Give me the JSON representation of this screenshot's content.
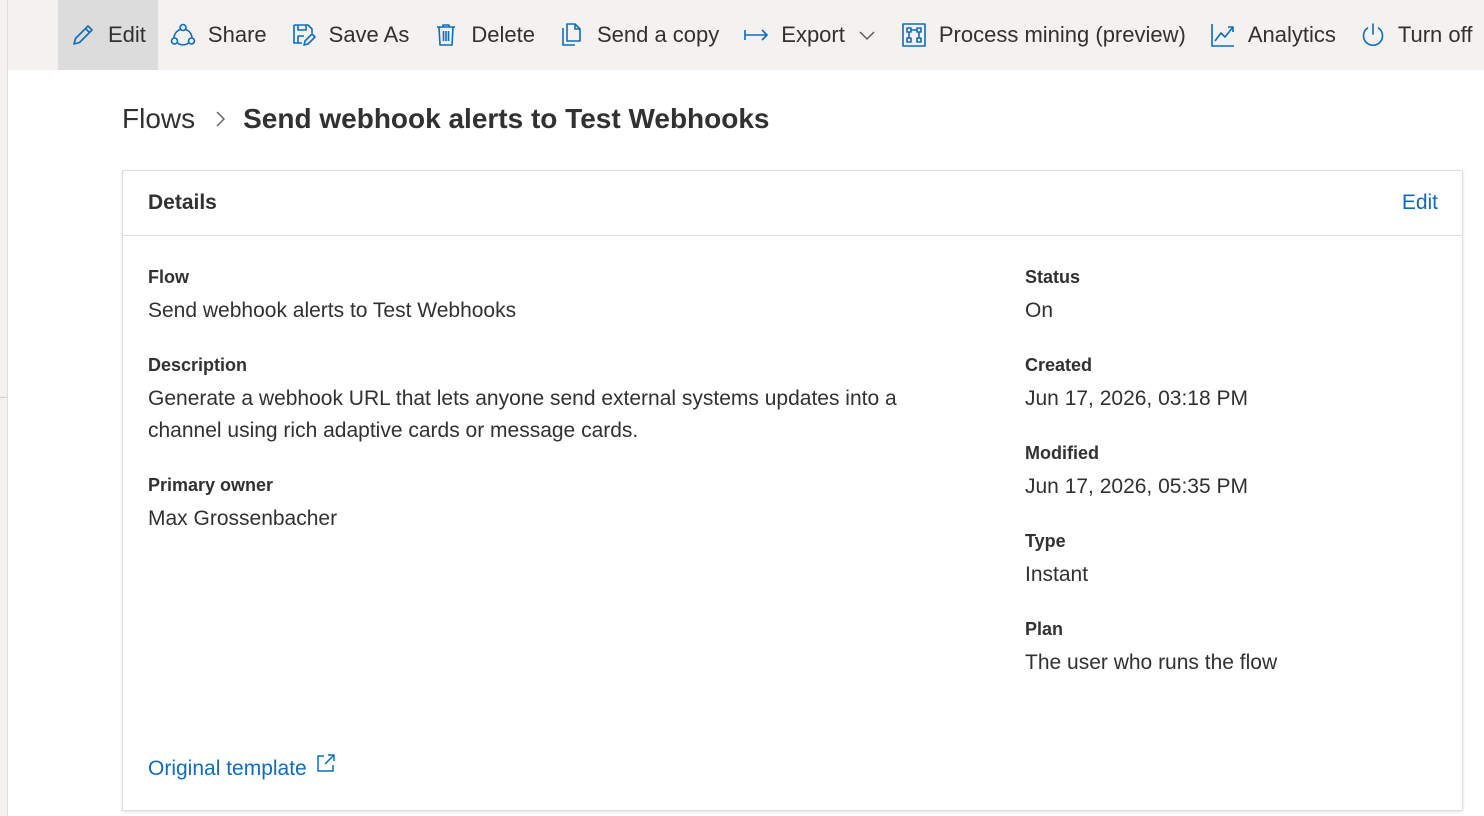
{
  "command_bar": {
    "edit": "Edit",
    "share": "Share",
    "save_as": "Save As",
    "delete": "Delete",
    "send_copy": "Send a copy",
    "export": "Export",
    "process_mining": "Process mining (preview)",
    "analytics": "Analytics",
    "turn_off": "Turn off"
  },
  "breadcrumb": {
    "root": "Flows",
    "current": "Send webhook alerts to Test Webhooks"
  },
  "details": {
    "title": "Details",
    "edit": "Edit",
    "flow_label": "Flow",
    "flow_value": "Send webhook alerts to Test Webhooks",
    "description_label": "Description",
    "description_value": "Generate a webhook URL that lets anyone send external systems updates into a channel using rich adaptive cards or message cards.",
    "owner_label": "Primary owner",
    "owner_value": "Max Grossenbacher",
    "status_label": "Status",
    "status_value": "On",
    "created_label": "Created",
    "created_value": "Jun 17, 2026, 03:18 PM",
    "modified_label": "Modified",
    "modified_value": "Jun 17, 2026, 05:35 PM",
    "type_label": "Type",
    "type_value": "Instant",
    "plan_label": "Plan",
    "plan_value": "The user who runs the flow",
    "template_link": "Original template"
  },
  "colors": {
    "accent": "#0f6cbd",
    "command_bar_bg": "#f3f2f1",
    "active_bg": "#dcdcdc",
    "text": "#323130"
  }
}
